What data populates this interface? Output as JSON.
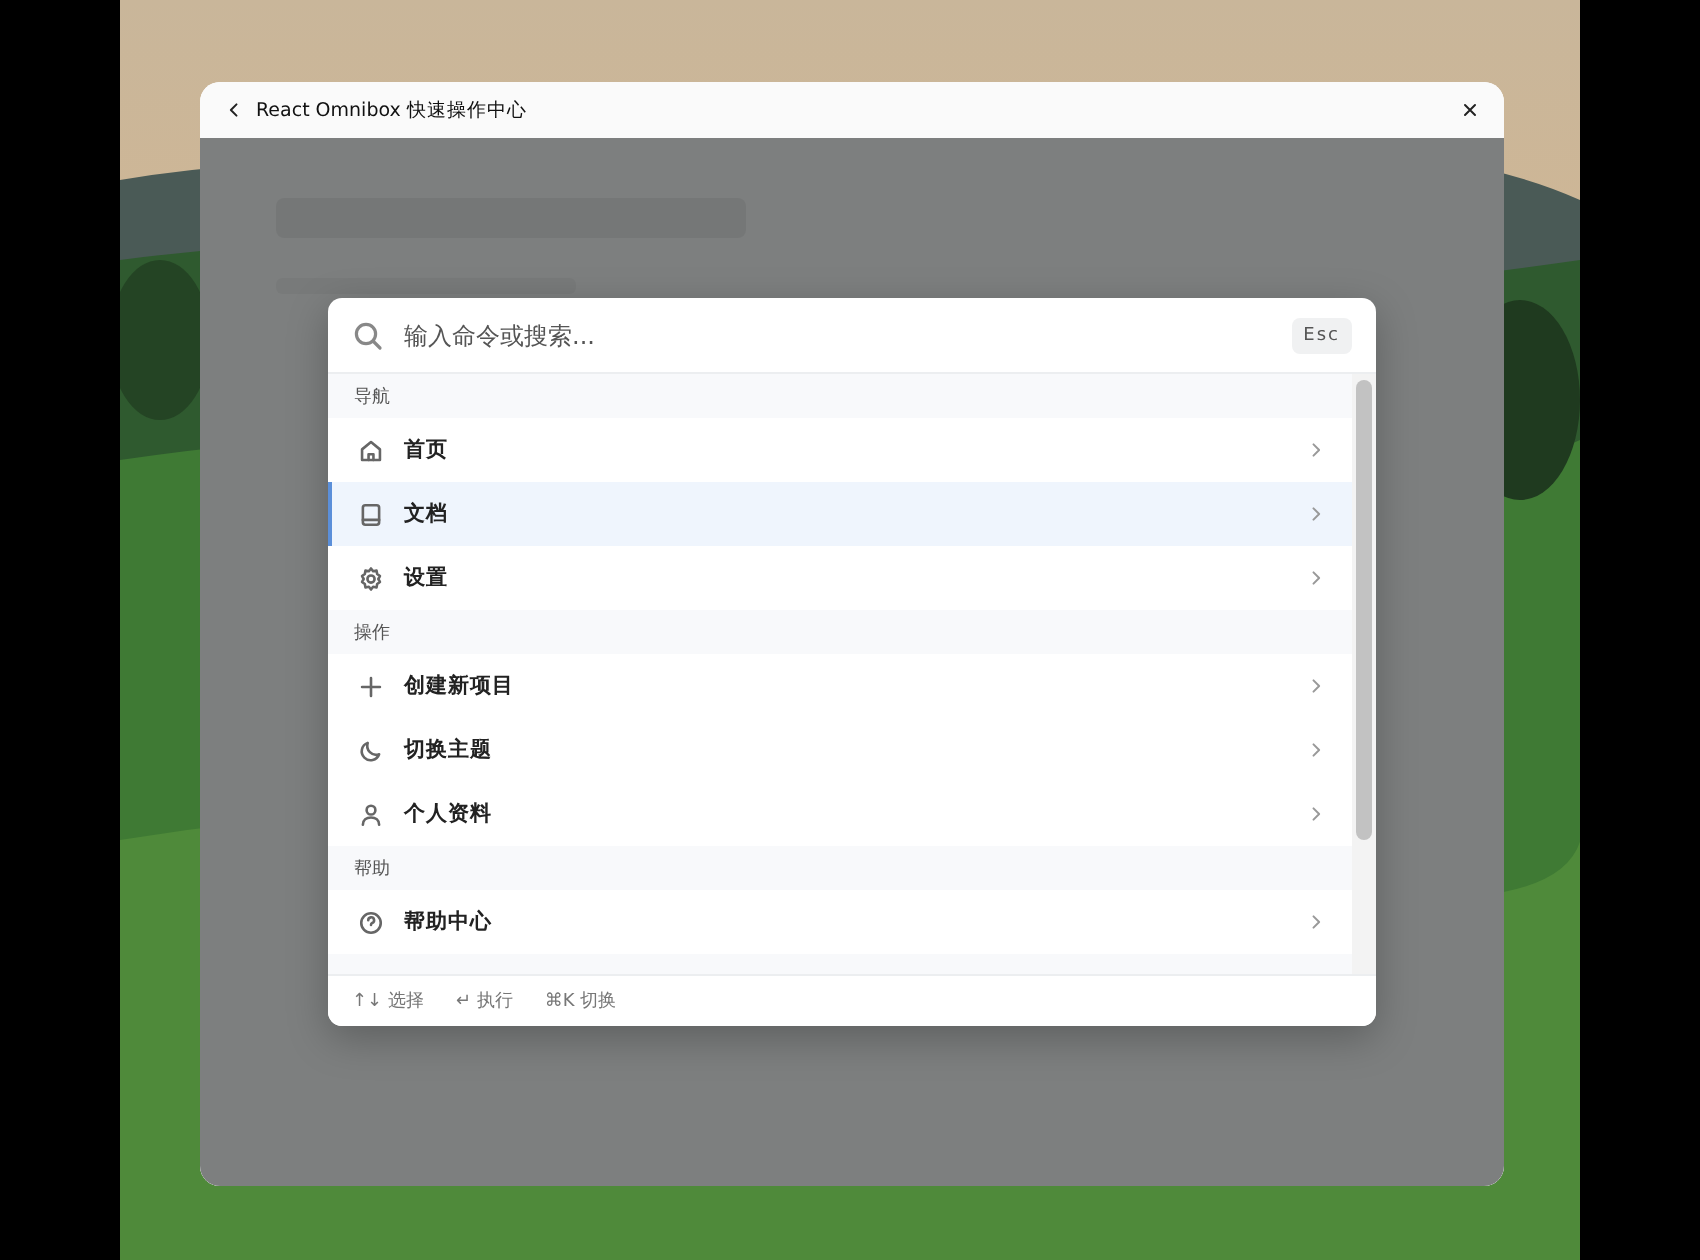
{
  "window": {
    "title": "React Omnibox 快速操作中心"
  },
  "palette": {
    "search": {
      "placeholder": "输入命令或搜索..."
    },
    "esc_key": "Esc",
    "groups": [
      {
        "title": "导航",
        "items": [
          {
            "label": "首页",
            "kind": "home",
            "selected": false
          },
          {
            "label": "文档",
            "kind": "book",
            "selected": true
          },
          {
            "label": "设置",
            "kind": "gear",
            "selected": false
          }
        ]
      },
      {
        "title": "操作",
        "items": [
          {
            "label": "创建新项目",
            "kind": "plus",
            "selected": false
          },
          {
            "label": "切换主题",
            "kind": "moon",
            "selected": false
          },
          {
            "label": "个人资料",
            "kind": "user",
            "selected": false
          }
        ]
      },
      {
        "title": "帮助",
        "items": [
          {
            "label": "帮助中心",
            "kind": "help",
            "selected": false
          }
        ]
      }
    ],
    "hints": [
      "↑↓ 选择",
      "↵ 执行",
      "⌘K 切换"
    ]
  }
}
